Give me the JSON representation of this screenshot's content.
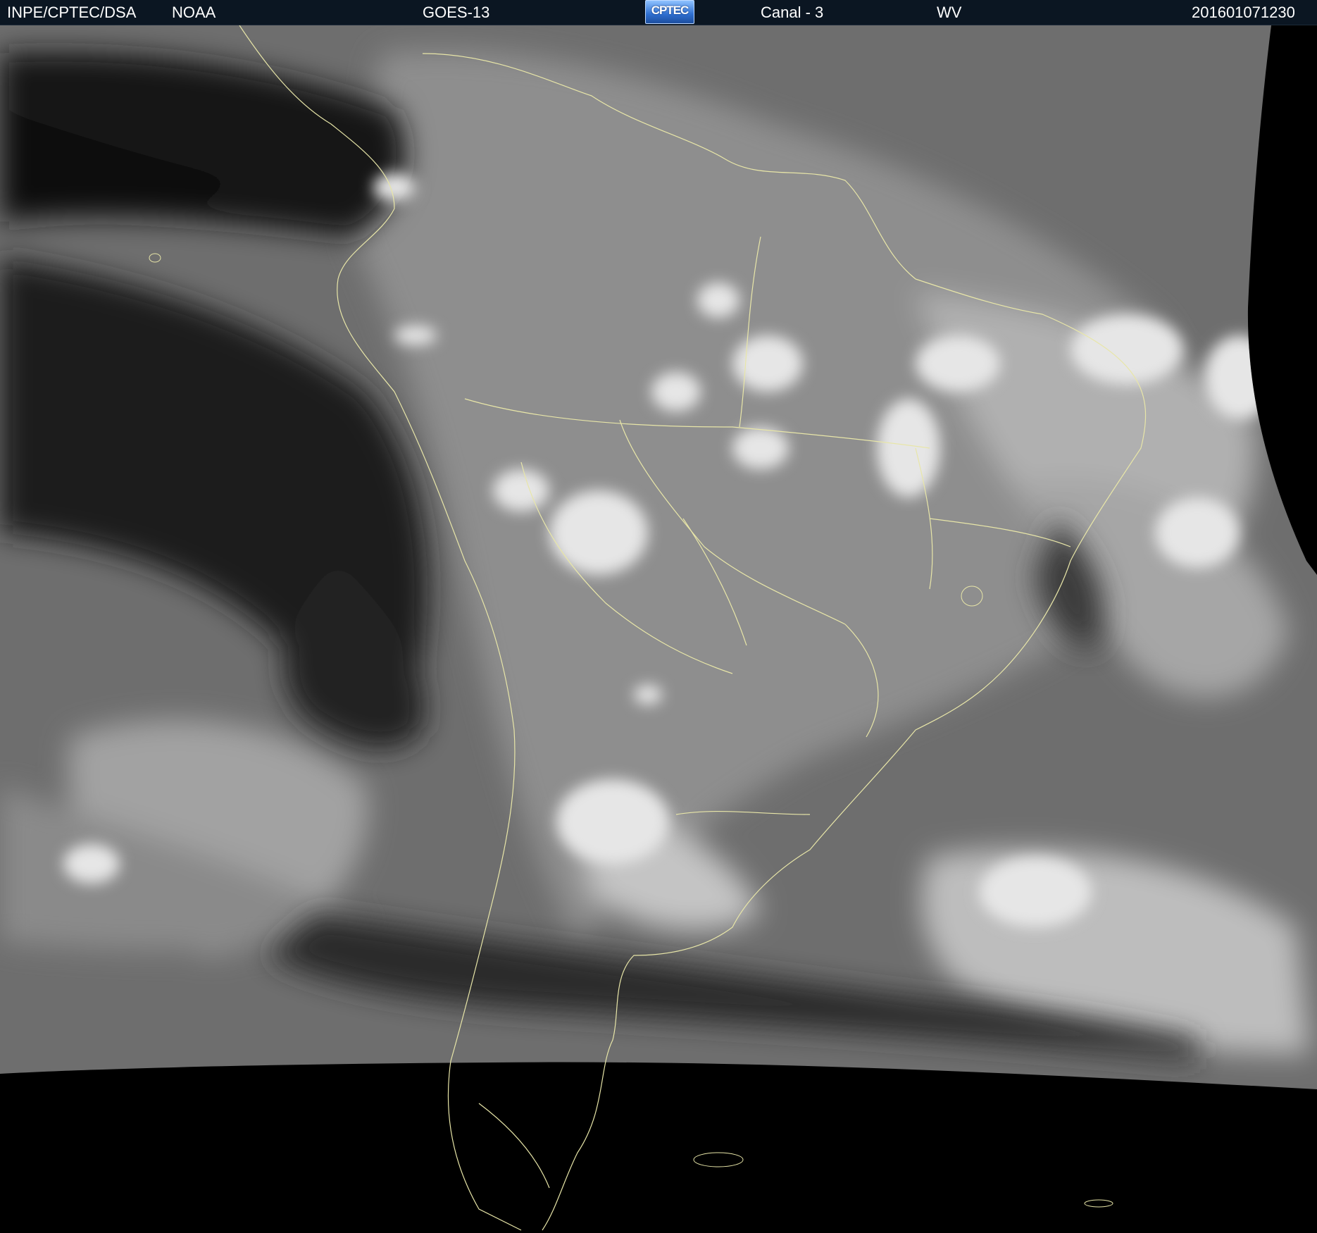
{
  "header": {
    "agency": "INPE/CPTEC/DSA",
    "provider": "NOAA",
    "satellite": "GOES-13",
    "logo_text": "CPTEC",
    "channel": "Canal - 3",
    "band": "WV",
    "timestamp": "201601071230"
  },
  "colors": {
    "header_background": "#0b1622",
    "header_text": "#ffffff",
    "coastline_overlay": "#e8e6a8",
    "space_background": "#000000",
    "logo_blue": "#2f6fd0"
  }
}
